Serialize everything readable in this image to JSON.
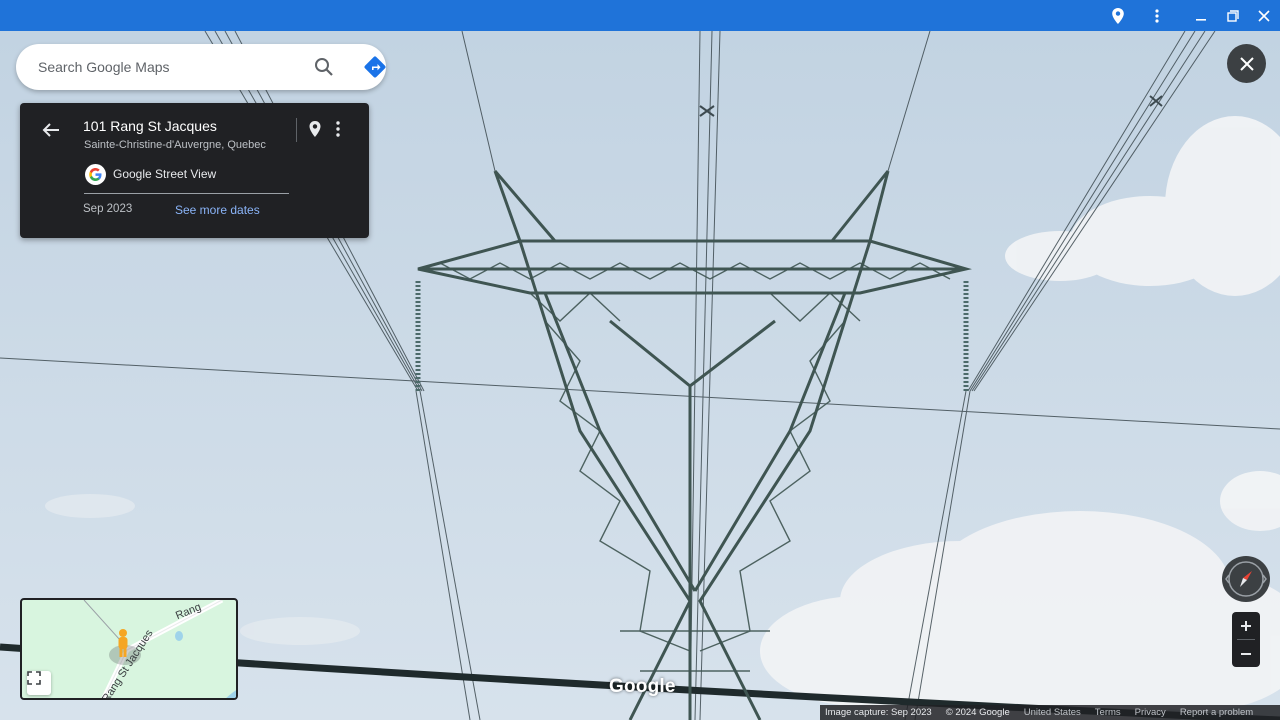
{
  "window": {
    "icons": [
      "location-icon",
      "more-vert-icon",
      "minimize-icon",
      "restore-icon",
      "close-window-icon"
    ]
  },
  "search": {
    "placeholder": "Search Google Maps",
    "search_icon": "search-icon",
    "directions_icon": "directions-icon"
  },
  "card": {
    "title": "101 Rang St Jacques",
    "subtitle": "Sainte-Christine-d'Auvergne, Quebec",
    "source": "Google Street View",
    "date": "Sep 2023",
    "see_more": "See more dates"
  },
  "minimap": {
    "road_label_1": "Rang St Jacques",
    "road_label_2": "Rang"
  },
  "watermark": "Google",
  "footer": {
    "capture": "Image capture: Sep 2023",
    "copyright": "© 2024 Google",
    "region": "United States",
    "terms": "Terms",
    "privacy": "Privacy",
    "report": "Report a problem"
  },
  "colors": {
    "topbar": "#1f73d9",
    "card_bg": "#202124",
    "link": "#8ab4f8",
    "sky": "#cfdce7",
    "tower": "#3f5552"
  }
}
